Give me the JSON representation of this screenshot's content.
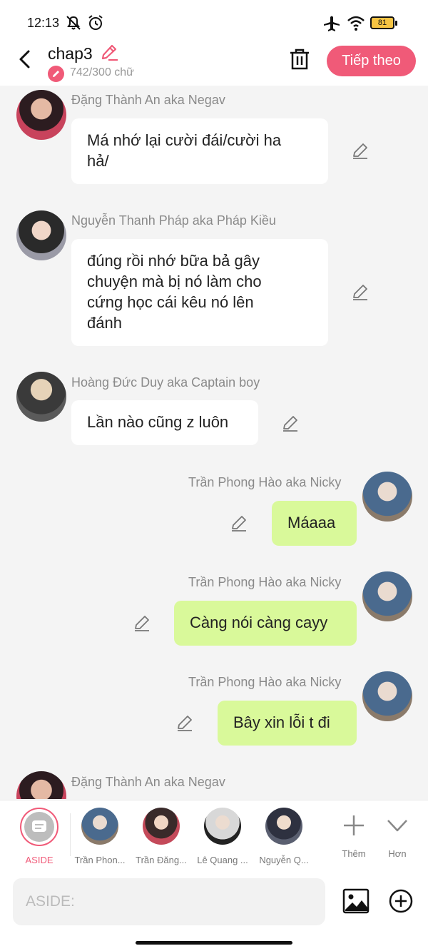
{
  "status": {
    "time": "12:13",
    "battery": "81"
  },
  "header": {
    "title": "chap3",
    "word_count": "742/300 chữ",
    "next_label": "Tiếp theo"
  },
  "messages": [
    {
      "sender": "Đặng Thành An aka Negav",
      "lines": [
        "Má nhớ lại cười đái/cười ha",
        "hả/"
      ],
      "side": "left"
    },
    {
      "sender": "Nguyễn Thanh Pháp aka Pháp Kiều",
      "lines": [
        "đúng rồi nhớ bữa bả gây",
        "chuyện mà bị nó làm cho",
        "cứng học cái kêu nó lên",
        "đánh"
      ],
      "side": "left"
    },
    {
      "sender": "Hoàng Đức Duy aka Captain boy",
      "lines": [
        "Lần nào cũng z luôn"
      ],
      "side": "left"
    },
    {
      "sender": "Trần Phong Hào aka Nicky",
      "lines": [
        "Máaaa"
      ],
      "side": "right"
    },
    {
      "sender": "Trần Phong Hào aka Nicky",
      "lines": [
        "Càng nói càng cayy"
      ],
      "side": "right"
    },
    {
      "sender": "Trần Phong Hào aka Nicky",
      "lines": [
        "Bây xin lỗi t đi"
      ],
      "side": "right"
    },
    {
      "sender": "Đặng Thành An aka Negav",
      "lines": [],
      "side": "left"
    }
  ],
  "char_bar": {
    "aside_label": "ASIDE",
    "characters": [
      "Trần Phon...",
      "Trần Đăng...",
      "Lê Quang ...",
      "Nguyễn Q..."
    ],
    "more_label": "Thêm",
    "collapse_label": "Hơn"
  },
  "input": {
    "placeholder": "ASIDE:"
  },
  "colors": {
    "accent": "#f05a78",
    "right_bubble": "#d9f99a",
    "left_bubble": "#ffffff"
  }
}
